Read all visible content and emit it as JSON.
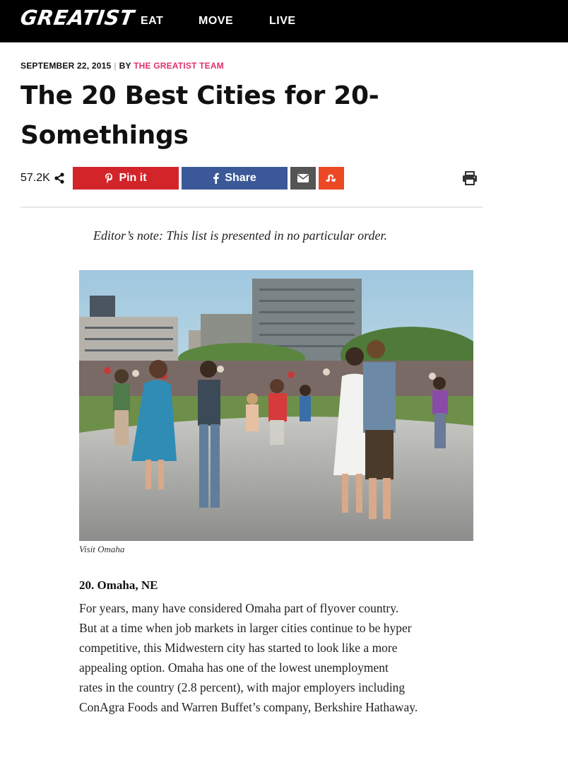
{
  "header": {
    "logo": "GREATIST",
    "nav": [
      "EAT",
      "MOVE",
      "LIVE"
    ]
  },
  "article": {
    "date": "SEPTEMBER 22, 2015",
    "separator": "|",
    "by": "BY",
    "author": "THE GREATIST TEAM",
    "title": "The 20 Best Cities for 20-Somethings",
    "share_count": "57.2K",
    "share_icon": "share-icon",
    "buttons": {
      "pin_label": "Pin it",
      "pin_icon": "pinterest-icon",
      "share_label": "Share",
      "share_icon": "facebook-icon",
      "mail_icon": "envelope-icon",
      "stumble_icon": "stumbleupon-icon",
      "print_icon": "print-icon"
    },
    "editor_note": "Editor’s note: This list is presented in no particular order.",
    "image_caption": "Visit Omaha",
    "section_title": "20. Omaha, NE",
    "body_lines": [
      "For years, many have considered Omaha part of flyover country.",
      "But at a time when job markets in larger cities continue to be hyper",
      "competitive, this Midwestern city has started to look like a more",
      "appealing option. Omaha has one of the lowest unemployment",
      "rates in the country (2.8 percent), with major employers including",
      "ConAgra Foods and Warren Buffet’s company, Berkshire Hathaway."
    ]
  },
  "colors": {
    "nav_bg": "#000000",
    "author": "#e0316b",
    "pinterest": "#d3242a",
    "facebook": "#3b5998",
    "email": "#555555",
    "stumbleupon": "#eb4924"
  }
}
